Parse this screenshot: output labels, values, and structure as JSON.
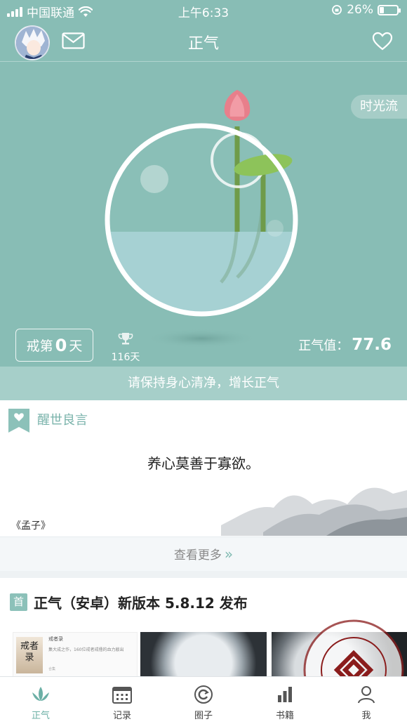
{
  "status_bar": {
    "carrier": "中国联通",
    "time": "上午6:33",
    "battery": "26%",
    "battery_level": 0.26
  },
  "nav": {
    "title": "正气"
  },
  "hero": {
    "time_flow_label": "时光流",
    "streak_prefix": "戒第",
    "streak_days": "0",
    "streak_suffix": "天",
    "best_days": "116天",
    "energy_label": "正气值：",
    "energy_value": "77.6",
    "slogan": "请保持身心清净，增长正气"
  },
  "wisdom": {
    "header": "醒世良言",
    "quote": "养心莫善于寡欲。",
    "source": "《孟子》",
    "more_label": "查看更多"
  },
  "news": {
    "badge": "首",
    "title": "正气（安卓）新版本 5.8.12 发布",
    "thumb1_book": "戒者录",
    "thumb1_title": "戒者录",
    "thumb1_desc": "集大成之作，160位戒者戒撸的血力敲出",
    "thumb1_meta": "合集"
  },
  "tabs": [
    {
      "label": "正气",
      "icon": "lotus-icon",
      "active": true
    },
    {
      "label": "记录",
      "icon": "calendar-icon",
      "active": false
    },
    {
      "label": "圈子",
      "icon": "refresh-circle-icon",
      "active": false
    },
    {
      "label": "书籍",
      "icon": "bar-chart-icon",
      "active": false
    },
    {
      "label": "我",
      "icon": "profile-icon",
      "active": false
    }
  ],
  "colors": {
    "hero_bg": "#88bdb5",
    "accent": "#6cb0a6",
    "slogan_bg": "#a6cfc9"
  }
}
